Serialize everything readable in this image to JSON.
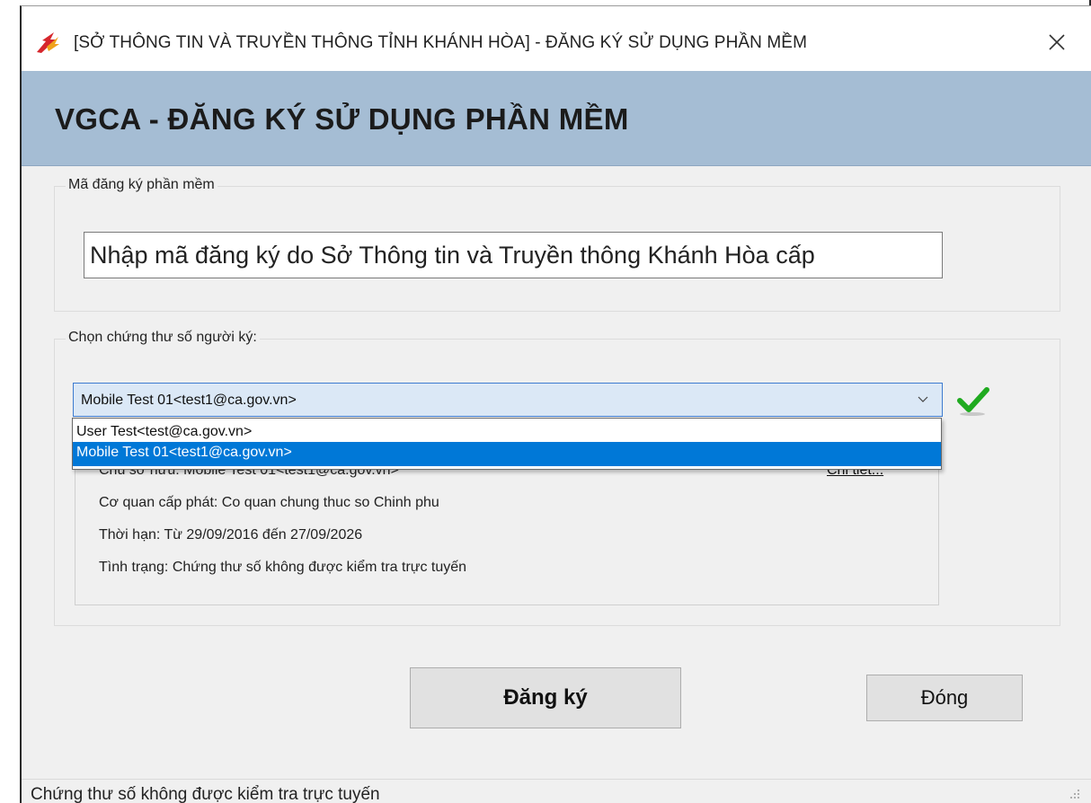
{
  "window": {
    "title": "[SỞ THÔNG TIN VÀ TRUYỀN THÔNG TỈNH KHÁNH HÒA] - ĐĂNG KÝ SỬ DỤNG PHẦN MỀM",
    "app_icon": "app-logo-icon",
    "close_icon": "close-icon"
  },
  "banner": {
    "title": "VGCA - ĐĂNG KÝ SỬ DỤNG PHẦN MỀM",
    "color": "#a5bdd4"
  },
  "registration_code": {
    "legend": "Mã đăng ký phần mềm",
    "value": "",
    "placeholder": "Nhập mã đăng ký do Sở Thông tin và Truyền thông Khánh Hòa cấp"
  },
  "certificate": {
    "legend": "Chọn chứng thư số người ký:",
    "selected": "Mobile Test 01<test1@ca.gov.vn>",
    "options": [
      "User Test<test@ca.gov.vn>",
      "Mobile Test 01<test1@ca.gov.vn>"
    ],
    "highlighted_option_index": 1,
    "valid_icon": "check-icon",
    "valid_color": "#1faa1f",
    "highlight_color": "#0078d7",
    "info": {
      "owner": "Chủ sở hữu: Mobile Test 01<test1@ca.gov.vn>",
      "issuer": "Cơ quan cấp phát: Co quan chung thuc so Chinh phu",
      "validity": "Thời hạn: Từ 29/09/2016 đến 27/09/2026",
      "status": "Tình trạng: Chứng thư số không được kiểm tra trực tuyến",
      "detail_link": "Chi tiết..."
    }
  },
  "buttons": {
    "register": "Đăng ký",
    "close": "Đóng"
  },
  "statusbar": {
    "text": "Chứng thư số không được kiểm tra trực tuyến",
    "grip_icon": "resize-grip-icon"
  }
}
